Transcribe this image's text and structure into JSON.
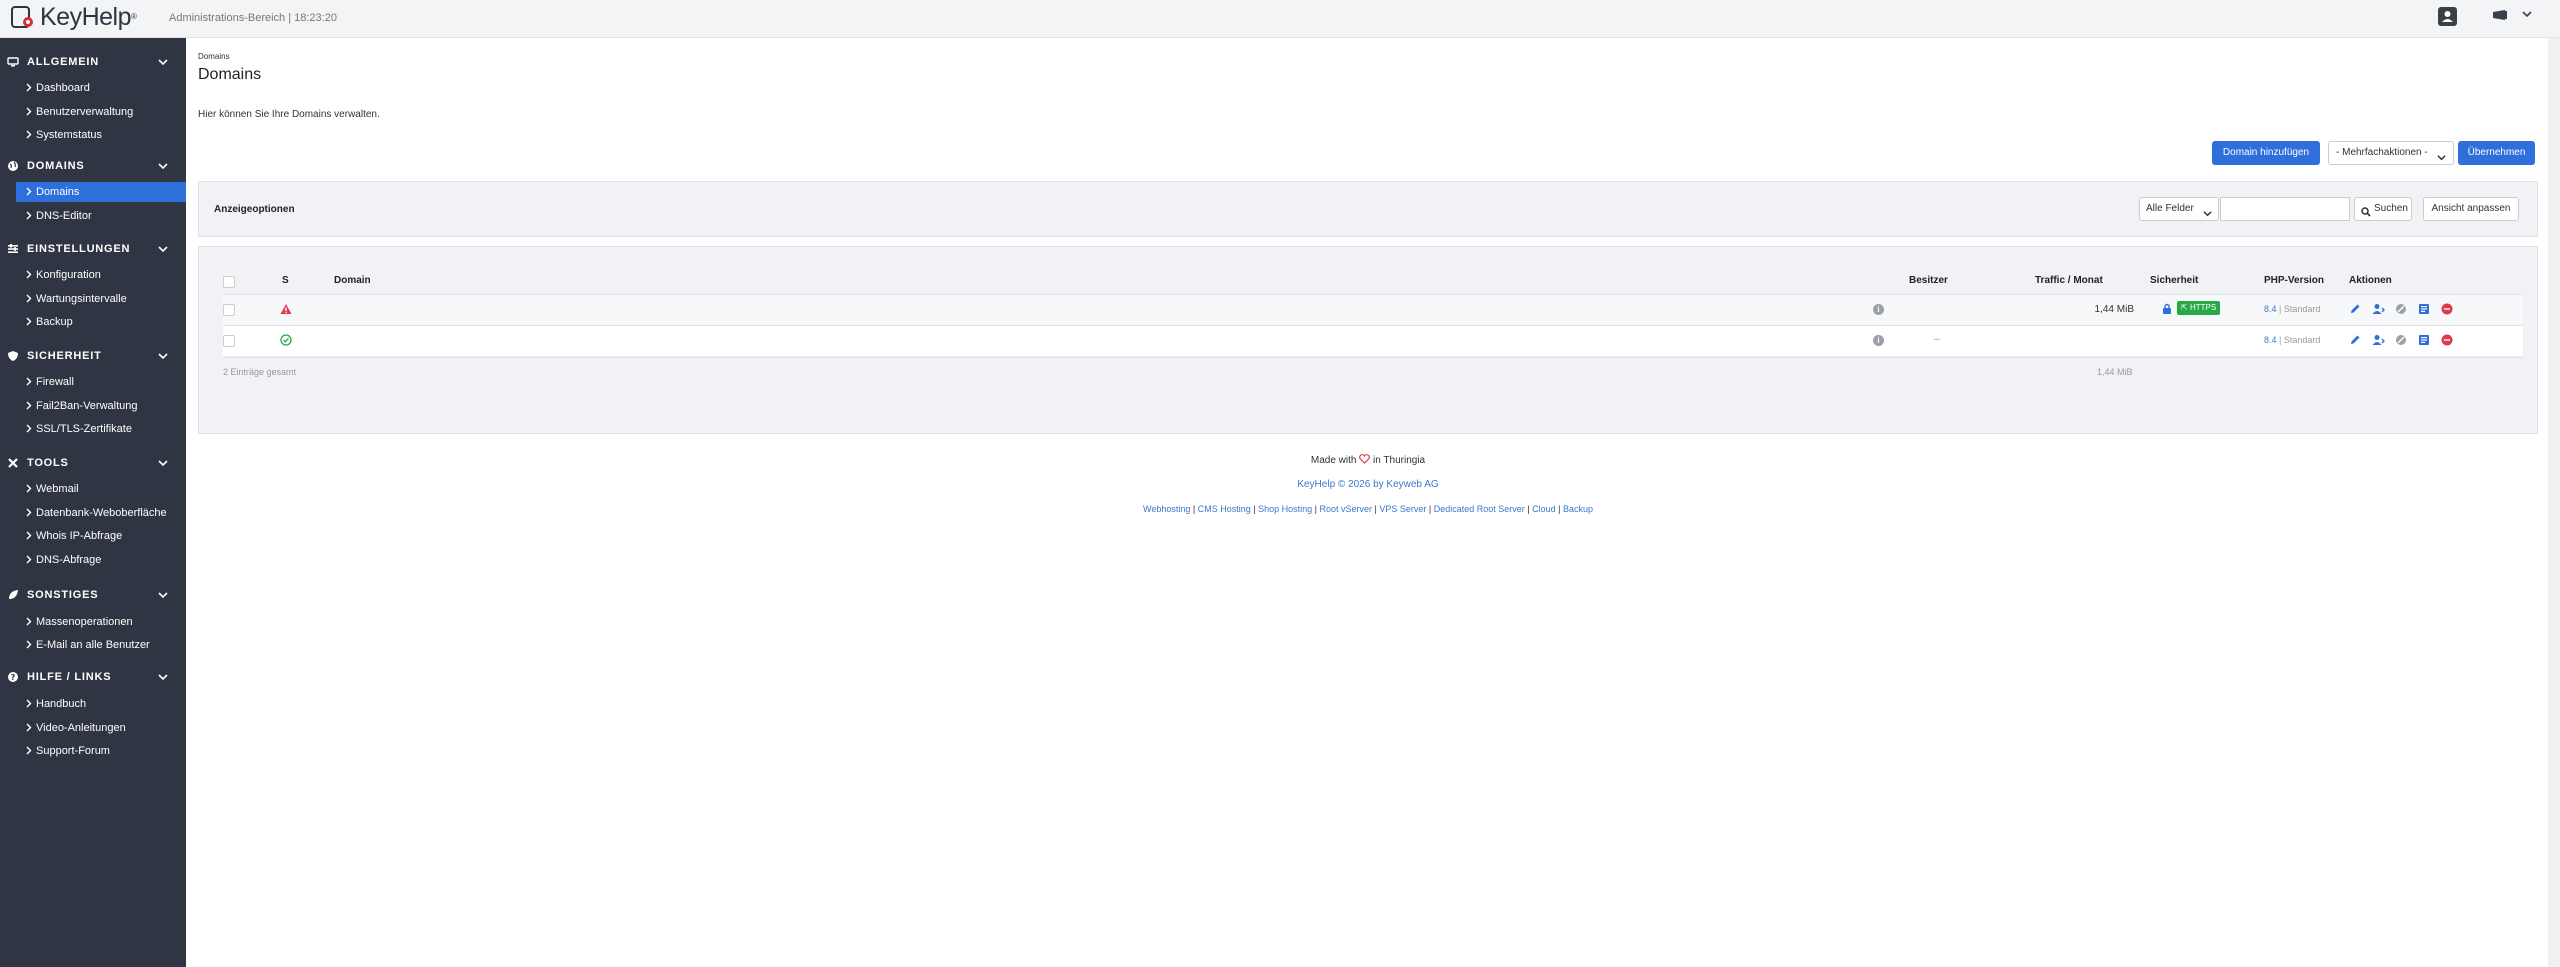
{
  "app": {
    "logo_text": "KeyHelp",
    "logo_mark": "®",
    "admin_label": "Administrations-Bereich | 18:23:20"
  },
  "sidebar": {
    "sections": [
      {
        "title": "ALLGEMEIN",
        "icon": "monitor-icon",
        "items": [
          "Dashboard",
          "Benutzerverwaltung",
          "Systemstatus"
        ]
      },
      {
        "title": "DOMAINS",
        "icon": "globe-icon",
        "items": [
          "Domains",
          "DNS-Editor"
        ]
      },
      {
        "title": "EINSTELLUNGEN",
        "icon": "sliders-icon",
        "items": [
          "Konfiguration",
          "Wartungsintervalle",
          "Backup"
        ]
      },
      {
        "title": "SICHERHEIT",
        "icon": "shield-icon",
        "items": [
          "Firewall",
          "Fail2Ban-Verwaltung",
          "SSL/TLS-Zertifikate"
        ]
      },
      {
        "title": "TOOLS",
        "icon": "tools-icon",
        "items": [
          "Webmail",
          "Datenbank-Weboberfläche",
          "Whois IP-Abfrage",
          "DNS-Abfrage"
        ]
      },
      {
        "title": "SONSTIGES",
        "icon": "leaf-icon",
        "items": [
          "Massenoperationen",
          "E-Mail an alle Benutzer"
        ]
      },
      {
        "title": "HILFE / LINKS",
        "icon": "question-icon",
        "items": [
          "Handbuch",
          "Video-Anleitungen",
          "Support-Forum"
        ]
      }
    ],
    "active_item": "Domains"
  },
  "main": {
    "breadcrumb": "Domains",
    "title": "Domains",
    "description": "Hier können Sie Ihre Domains verwalten.",
    "add_button": "Domain hinzufügen",
    "bulk_select": "- Mehrfachaktionen -",
    "apply_button": "Übernehmen",
    "options_title": "Anzeigeoptionen",
    "filter_select": "Alle Felder",
    "search_value": "",
    "search_button": "Suchen",
    "view_button": "Ansicht anpassen",
    "table": {
      "headers": {
        "status": "S",
        "domain": "Domain",
        "owner": "Besitzer",
        "traffic": "Traffic / Monat",
        "security": "Sicherheit",
        "php": "PHP-Version",
        "actions": "Aktionen"
      },
      "rows": [
        {
          "status": "warning",
          "owner": "",
          "traffic": "1,44 MiB",
          "https": "HTTPS",
          "php_version": "8.4",
          "php_mode": "Standard"
        },
        {
          "status": "ok",
          "owner": "–",
          "traffic": "",
          "https": "",
          "php_version": "8.4",
          "php_mode": "Standard"
        }
      ],
      "summary_count": "2 Einträge gesamt",
      "summary_traffic": "1,44 MiB"
    }
  },
  "footer": {
    "made_with_prefix": "Made with",
    "made_with_suffix": "in Thuringia",
    "copyright": "KeyHelp © 2026 by Keyweb AG",
    "links": [
      "Webhosting",
      "CMS Hosting",
      "Shop Hosting",
      "Root vServer",
      "VPS Server",
      "Dedicated Root Server",
      "Cloud",
      "Backup"
    ]
  },
  "colors": {
    "sidebar_bg": "#2f3542",
    "accent": "#2f6fdb",
    "danger": "#e03a4e",
    "success": "#28a745",
    "link": "#3a78c9"
  }
}
